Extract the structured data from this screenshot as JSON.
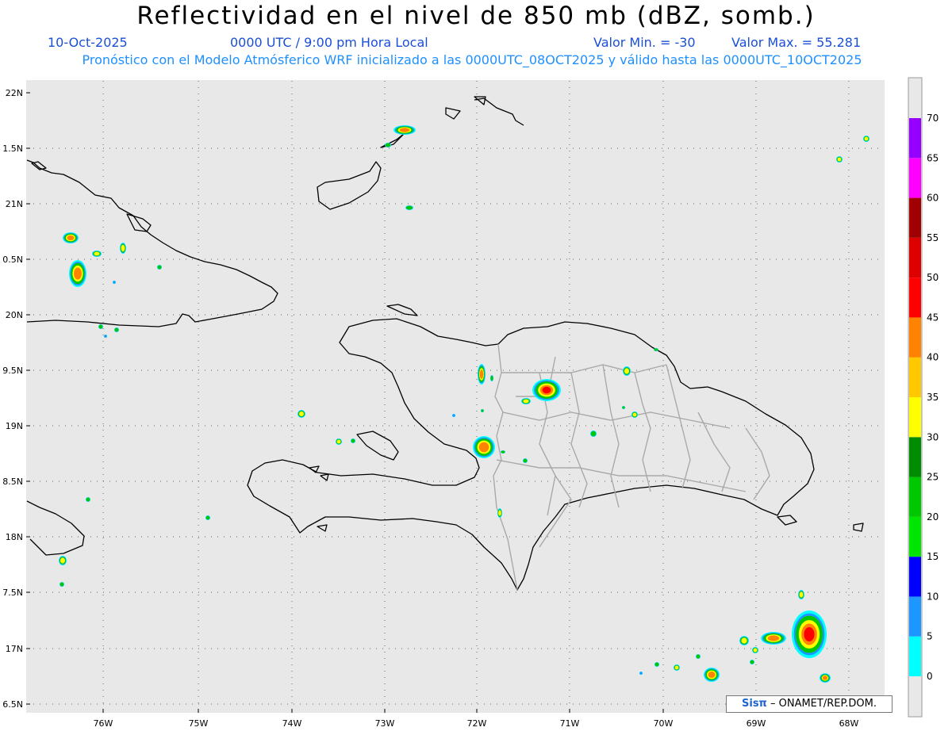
{
  "header": {
    "title": "Reflectividad en el nivel de 850 mb (dBZ, somb.)",
    "date": "10-Oct-2025",
    "time": "0000 UTC / 9:00 pm Hora Local",
    "valmin": "Valor Min. = -30",
    "valmax": "Valor Max. = 55.281",
    "subtitle": "Pronóstico con el Modelo Atmósferico WRF inicializado a las 0000UTC_08OCT2025 y válido hasta las  0000UTC_10OCT2025"
  },
  "map": {
    "lat_labels": [
      "22N",
      "1.5N",
      "21N",
      "0.5N",
      "20N",
      "9.5N",
      "19N",
      "8.5N",
      "18N",
      "7.5N",
      "17N",
      "6.5N"
    ],
    "lon_labels": [
      "76W",
      "75W",
      "74W",
      "73W",
      "72W",
      "71W",
      "70W",
      "69W",
      "68W"
    ],
    "background_color": "#e8e8e8",
    "coast_color": "#000000",
    "province_color": "#a9a9a9",
    "grid": "dotted"
  },
  "colorbar": {
    "labels": [
      "0",
      "5",
      "10",
      "15",
      "20",
      "25",
      "30",
      "35",
      "40",
      "45",
      "50",
      "55",
      "60",
      "65",
      "70"
    ],
    "colors": [
      "#00ffff",
      "#1e96ff",
      "#0000ff",
      "#00e600",
      "#00c800",
      "#008c00",
      "#ffff00",
      "#ffc800",
      "#ff8200",
      "#ff0000",
      "#dc0000",
      "#a00000",
      "#ff00ff",
      "#9600ff"
    ]
  },
  "credit": {
    "logo": "Sisπ",
    "text": " – ONAMET/REP.DOM."
  }
}
